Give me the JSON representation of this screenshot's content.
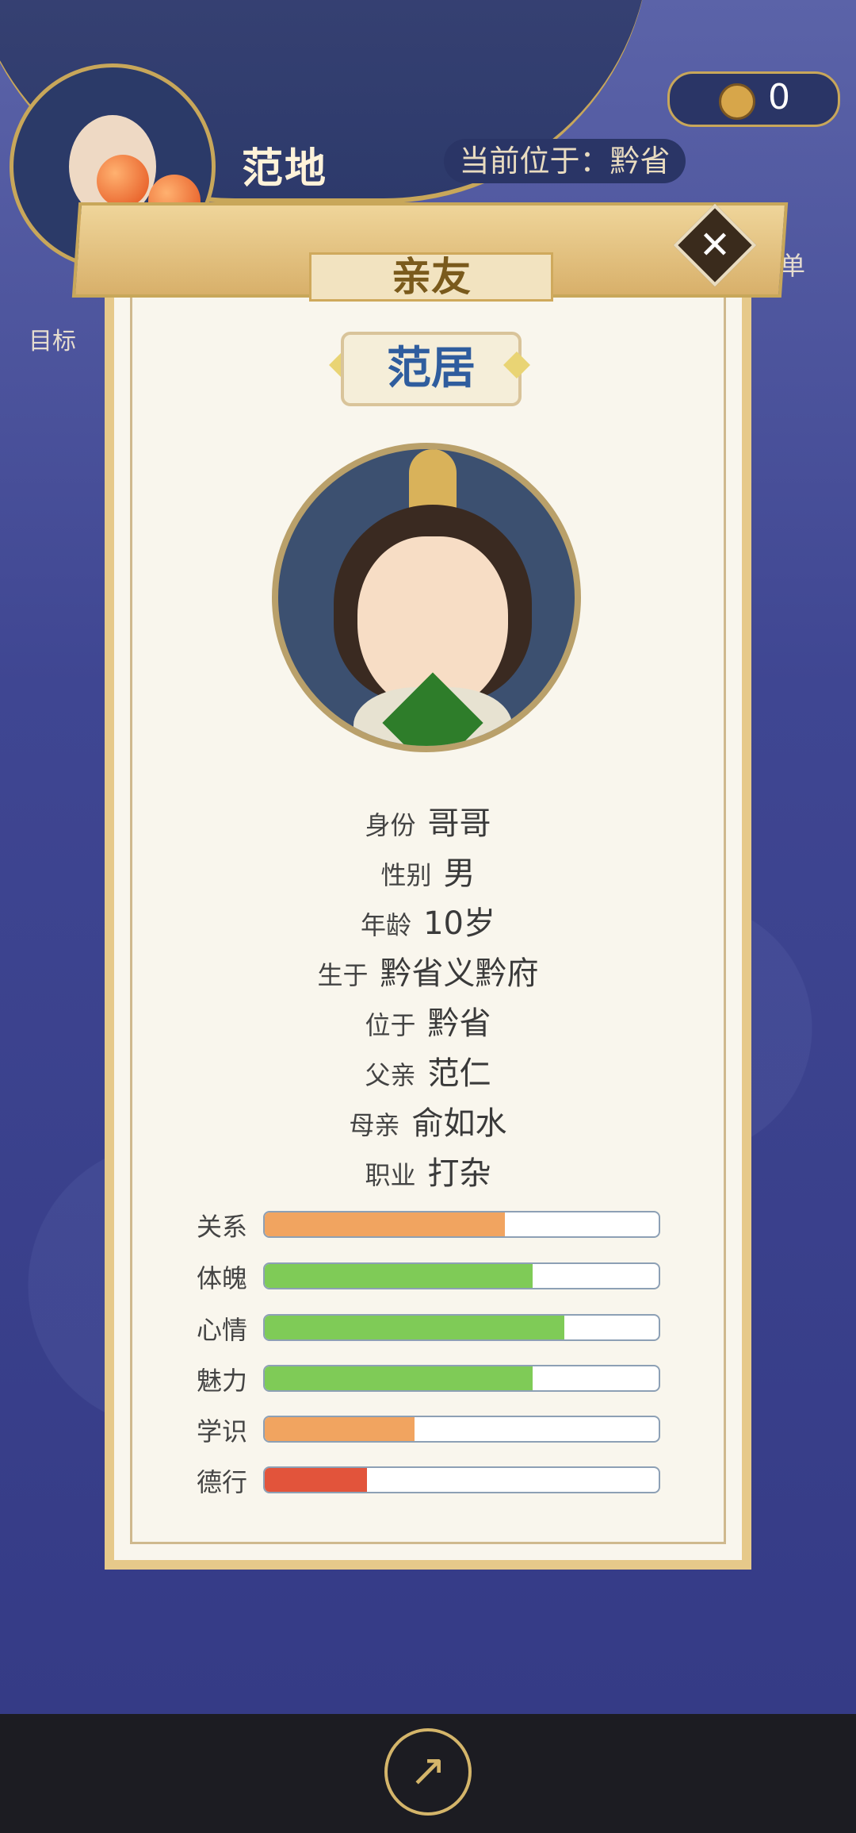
{
  "header": {
    "player_name": "范地",
    "location_text": "当前位于：黔省",
    "coins": "0",
    "goal_label": "目标",
    "menu_label": "菜单"
  },
  "panel": {
    "title": "亲友",
    "character_name": "范居",
    "close_icon": "close-icon"
  },
  "info": [
    {
      "label": "身份",
      "value": "哥哥"
    },
    {
      "label": "性别",
      "value": "男"
    },
    {
      "label": "年龄",
      "value": "10岁"
    },
    {
      "label": "生于",
      "value": "黔省义黔府"
    },
    {
      "label": "位于",
      "value": "黔省"
    },
    {
      "label": "父亲",
      "value": "范仁"
    },
    {
      "label": "母亲",
      "value": "俞如水"
    },
    {
      "label": "职业",
      "value": "打杂"
    }
  ],
  "stats": [
    {
      "label": "关系",
      "value": 0.61,
      "color": "#f1a460"
    },
    {
      "label": "体魄",
      "value": 0.68,
      "color": "#7fcb57"
    },
    {
      "label": "心情",
      "value": 0.76,
      "color": "#7fcb57"
    },
    {
      "label": "魅力",
      "value": 0.68,
      "color": "#7fcb57"
    },
    {
      "label": "学识",
      "value": 0.38,
      "color": "#f1a460"
    },
    {
      "label": "德行",
      "value": 0.26,
      "color": "#e2543b"
    }
  ],
  "bottom": {
    "share_icon": "share-icon"
  }
}
